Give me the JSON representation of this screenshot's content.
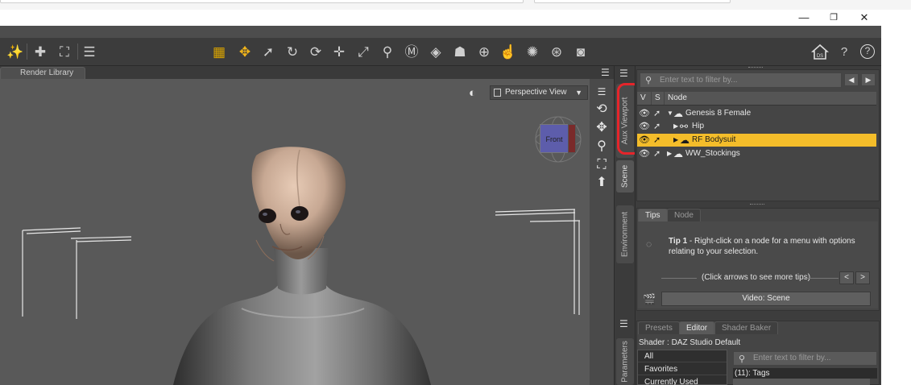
{
  "window": {
    "minimize_glyph": "—",
    "maximize_glyph": "❐",
    "close_glyph": "✕"
  },
  "toolbar": {
    "left_tools": [
      "node-weight-icon",
      "add-node-icon",
      "transform-icon",
      "align-icon"
    ],
    "center_tools": [
      "grid-icon",
      "universal-tool-icon",
      "select-icon",
      "rotate-icon",
      "twist-icon",
      "translate-icon",
      "scale-icon",
      "joint-editor-icon",
      "morph-icon",
      "geometry-editor-icon",
      "figure-icon",
      "camera-node-icon",
      "pointer-icon",
      "light-icon",
      "spotlight-icon",
      "render-icon"
    ],
    "right_tools": [
      "home-icon",
      "help-icon",
      "about-icon"
    ],
    "home_badge": "DS",
    "help_glyph": "?",
    "about_glyph": "?"
  },
  "viewport": {
    "tab_label": "Render Library",
    "view_select": "Perspective View",
    "cube_face_label": "Front"
  },
  "side_tabs": {
    "aux_viewport": "Aux Viewport",
    "scene": "Scene",
    "environment": "Environment",
    "parameters": "Parameters"
  },
  "scene": {
    "filter_placeholder": "Enter text to filter by...",
    "columns": {
      "v": "V",
      "s": "S",
      "node": "Node"
    },
    "rows": [
      {
        "label": "Genesis 8 Female",
        "selected": false
      },
      {
        "label": "Hip",
        "selected": false
      },
      {
        "label": "RF Bodysuit",
        "selected": true
      },
      {
        "label": "WW_Stockings",
        "selected": false
      }
    ]
  },
  "tips": {
    "tab_tips": "Tips",
    "tab_node": "Node",
    "tip_title": "Tip 1",
    "tip_body": " - Right-click on a node for a menu with options relating to your selection.",
    "more_tips": "(Click arrows to see more tips)",
    "prev": "<",
    "next": ">",
    "video_button": "Video: Scene"
  },
  "surfaces": {
    "tab_presets": "Presets",
    "tab_editor": "Editor",
    "tab_shader_baker": "Shader Baker",
    "shader_label": "Shader : DAZ Studio Default",
    "categories": [
      "All",
      "Favorites",
      "Currently Used"
    ],
    "filter_placeholder": "Enter text to filter by...",
    "tags_label": "(11): Tags"
  },
  "colors": {
    "selection": "#f4bd2a",
    "annotation": "#e5252b",
    "viewport_bg": "#595959"
  }
}
